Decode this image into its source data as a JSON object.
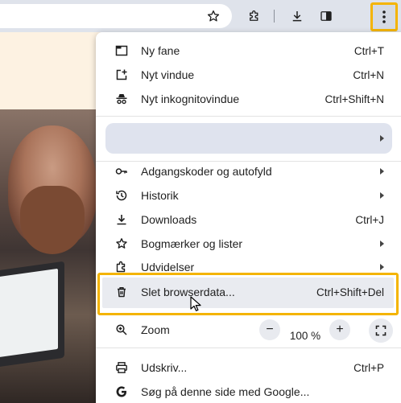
{
  "toolbar": {
    "icons": [
      "star-icon",
      "extensions-icon",
      "download-icon",
      "side-panel-icon",
      "more-vert-icon"
    ],
    "colors": {
      "highlight": "#f4b400"
    }
  },
  "menu": {
    "new_tab": {
      "label": "Ny fane",
      "shortcut": "Ctrl+T"
    },
    "new_window": {
      "label": "Nyt vindue",
      "shortcut": "Ctrl+N"
    },
    "incognito": {
      "label": "Nyt inkognitovindue",
      "shortcut": "Ctrl+Shift+N"
    },
    "passwords": {
      "label": "Adgangskoder og autofyld"
    },
    "history": {
      "label": "Historik"
    },
    "downloads": {
      "label": "Downloads",
      "shortcut": "Ctrl+J"
    },
    "bookmarks": {
      "label": "Bogmærker og lister"
    },
    "extensions": {
      "label": "Udvidelser"
    },
    "clear_data": {
      "label": "Slet browserdata...",
      "shortcut": "Ctrl+Shift+Del"
    },
    "zoom": {
      "label": "Zoom",
      "minus": "−",
      "value": "100 %",
      "plus": "+"
    },
    "print": {
      "label": "Udskriv...",
      "shortcut": "Ctrl+P"
    },
    "search_page": {
      "label": "Søg på denne side med Google..."
    }
  }
}
